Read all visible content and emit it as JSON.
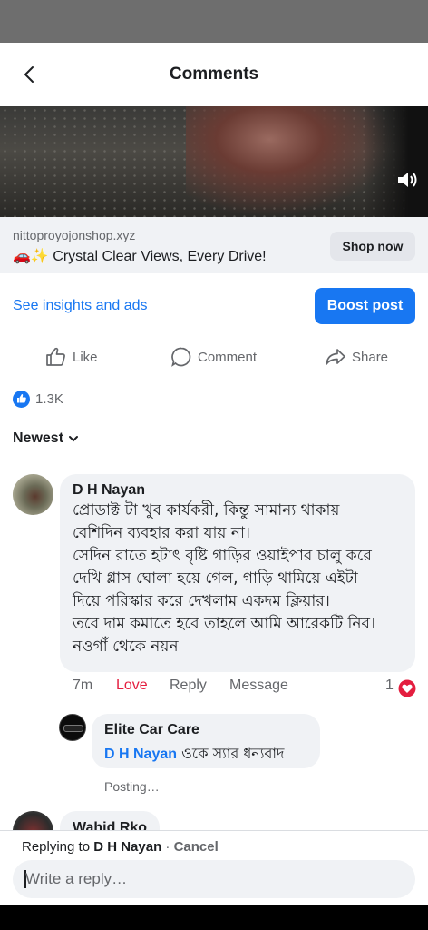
{
  "header": {
    "title": "Comments"
  },
  "ad": {
    "domain": "nittoproyojonshop.xyz",
    "emojis": "🚗✨",
    "title": "Crystal Clear Views, Every Drive!",
    "cta": "Shop now"
  },
  "post_actions": {
    "insights": "See insights and ads",
    "boost": "Boost post",
    "like": "Like",
    "comment": "Comment",
    "share": "Share"
  },
  "reactions": {
    "count": "1.3K"
  },
  "sort": {
    "label": "Newest"
  },
  "comments": [
    {
      "author": "D H Nayan",
      "text": "প্রোডাক্ট টা খুব কার্যকরী,  কিন্তু সামান্য থাকায়\nবেশিদিন ব্যবহার করা যায় না।\nসেদিন রাতে হটাৎ বৃষ্টি গাড়ির ওয়াইপার চালু করে\nদেখি গ্লাস ঘোলা হয়ে গেল,  গাড়ি থামিয়ে এইটা\nদিয়ে পরিস্কার করে দেখলাম একদম ক্লিয়ার।\nতবে দাম কমাতে হবে তাহলে আমি আরেকটি নিব।\nনওগাঁ থেকে নয়ন",
      "time": "7m",
      "reaction": "Love",
      "reply": "Reply",
      "message": "Message",
      "reaction_count": "1",
      "love_color": "#e41e3f"
    }
  ],
  "reply": {
    "author": "Elite Car Care",
    "mention": "D H Nayan",
    "text": " ওকে স্যার ধন্যবাদ",
    "status": "Posting…"
  },
  "next_comment": {
    "author": "Wahid Rko"
  },
  "composer": {
    "replying_prefix": "Replying to ",
    "replying_to": "D H Nayan",
    "cancel": "Cancel",
    "placeholder": "Write a reply…"
  },
  "colors": {
    "accent": "#1877f2",
    "love": "#e41e3f"
  }
}
